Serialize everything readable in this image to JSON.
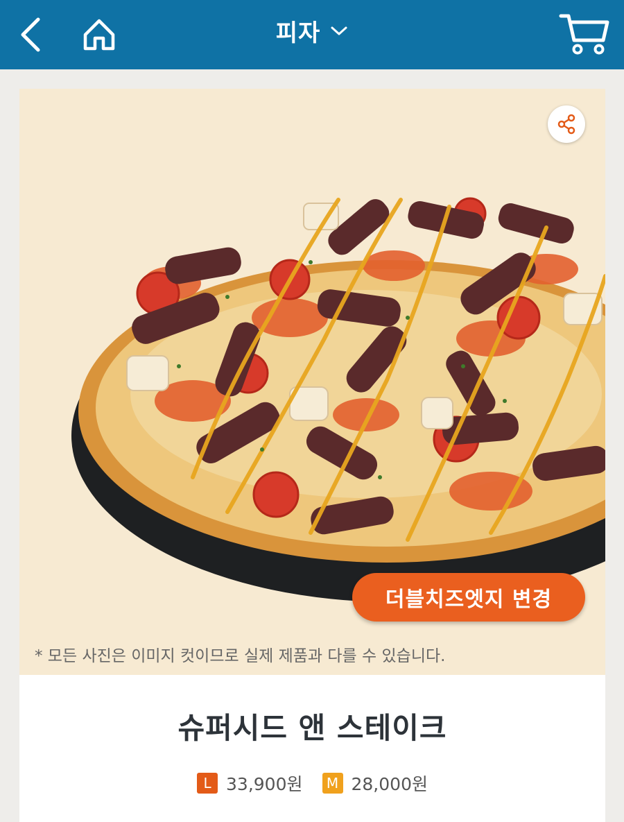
{
  "header": {
    "title": "피자",
    "back_icon": "chevron-left-icon",
    "home_icon": "home-icon",
    "cart_icon": "cart-icon",
    "background": "#0f72a5"
  },
  "product": {
    "image_alt": "pizza-photo",
    "edge_button_label": "더블치즈엣지 변경",
    "disclaimer": "* 모든 사진은 이미지 컷이므로 실제 제품과 다를 수 있습니다.",
    "name": "슈퍼시드 앤 스테이크",
    "prices": [
      {
        "size": "L",
        "amount": "33,900원",
        "color": "#e35b18"
      },
      {
        "size": "M",
        "amount": "28,000원",
        "color": "#f0a11d"
      }
    ]
  },
  "colors": {
    "accent": "#ea5f1f",
    "photo_background": "#f7ead2"
  }
}
